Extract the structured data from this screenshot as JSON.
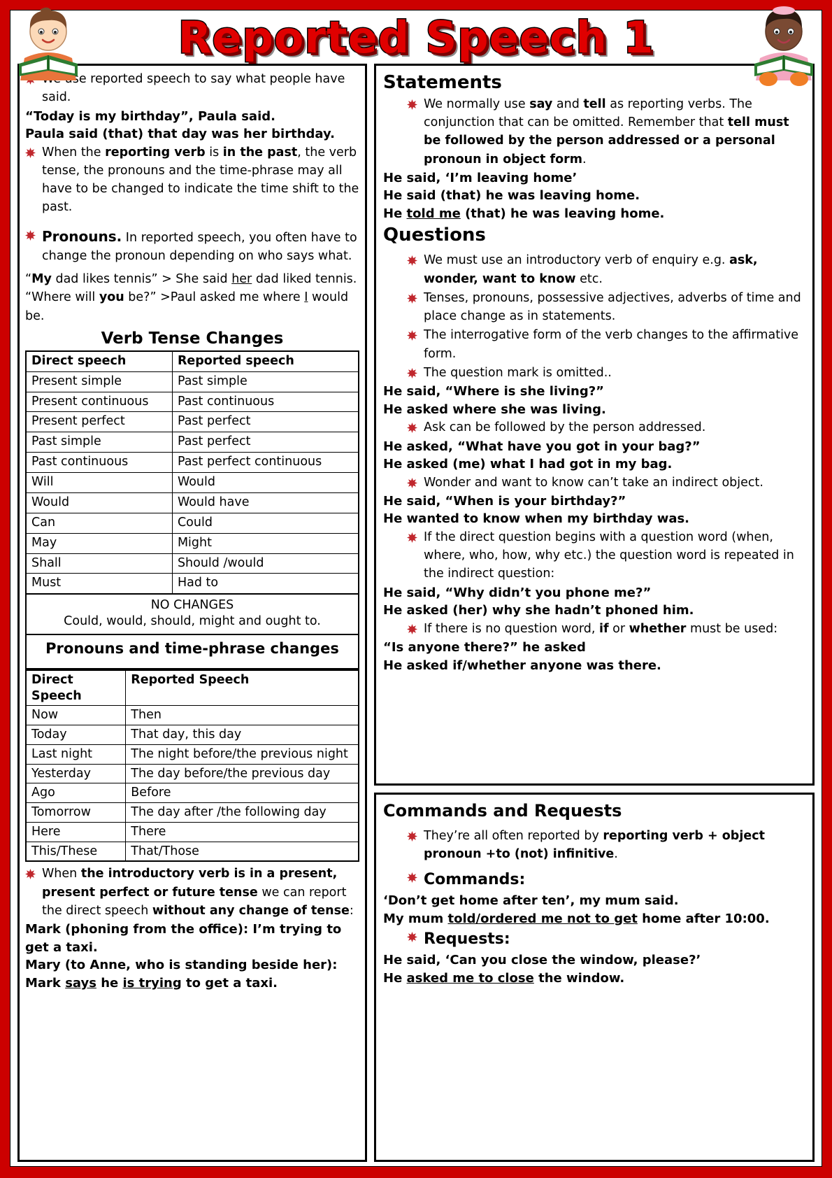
{
  "title": "Reported Speech 1",
  "theme": {
    "border_red": "#cc0000",
    "title_red": "#e00000",
    "bullet_red": "#c0272d"
  },
  "left": {
    "intro_bullet": "We use reported speech to say what people have said.",
    "example_1": "“Today is my birthday”, Paula said.",
    "example_2": "Paula said (that) that day was her birthday.",
    "bullet_past": {
      "p1": "When the ",
      "b1": "reporting verb",
      "p2": " is ",
      "b2": "in the past",
      "p3": ", the verb tense, the pronouns and the time-phrase may all have to be changed to indicate the time shift to the past."
    },
    "bullet_pronouns": {
      "head": "Pronouns.",
      "rest": " In reported speech, you often have to change the pronoun depending on who says what."
    },
    "pronoun_example_1": {
      "b1": "My",
      "p1": " dad likes tennis” > She said ",
      "u1": "her",
      "p2": " dad liked tennis."
    },
    "pronoun_example_1_open": "“",
    "pronoun_example_2": {
      "p0": "“Where will ",
      "b1": "you",
      "p1": " be?” >Paul asked me where ",
      "u1": "I",
      "p2": " would be."
    },
    "verb_tense_title": "Verb Tense Changes",
    "verb_table": {
      "headers": [
        "Direct speech",
        "Reported speech"
      ],
      "rows": [
        [
          "Present simple",
          "Past simple"
        ],
        [
          "Present continuous",
          "Past continuous"
        ],
        [
          "Present perfect",
          "Past perfect"
        ],
        [
          "Past simple",
          "Past perfect"
        ],
        [
          "Past continuous",
          "Past perfect continuous"
        ],
        [
          "Will",
          "Would"
        ],
        [
          "Would",
          "Would  have"
        ],
        [
          "Can",
          "Could"
        ],
        [
          "May",
          "Might"
        ],
        [
          "Shall",
          "Should /would"
        ],
        [
          "Must",
          "Had to"
        ]
      ]
    },
    "no_changes_title": "NO CHANGES",
    "no_changes_sub": "Could, would, should, might and ought to.",
    "pronouns_time_title": "Pronouns and time-phrase changes",
    "time_table": {
      "headers": [
        "Direct Speech",
        "Reported Speech"
      ],
      "rows": [
        [
          "Now",
          "Then"
        ],
        [
          "Today",
          "That day, this day"
        ],
        [
          "Last night",
          "The night before/the previous night"
        ],
        [
          "Yesterday",
          "The day before/the previous day"
        ],
        [
          "Ago",
          "Before"
        ],
        [
          "Tomorrow",
          "The day after /the following day"
        ],
        [
          "Here",
          "There"
        ],
        [
          "This/These",
          "That/Those"
        ]
      ]
    },
    "bullet_intro_verb": {
      "p1": "When ",
      "b1": "the introductory verb is in a present, present perfect or future tense",
      "p2": " we can report the direct speech ",
      "b2": "without any change of tense",
      "p3": ":"
    },
    "mark_line": "Mark (phoning from the office): I’m trying to get a taxi.",
    "mary_line": {
      "p1": "Mary (to Anne, who is standing beside her): Mark ",
      "u1": "says",
      "p2": " he ",
      "u2": "is trying",
      "p3": " to get a taxi."
    }
  },
  "right": {
    "statements_heading": "Statements",
    "statements_bullet": {
      "p1": "We normally use ",
      "b1": "say",
      "p2": " and ",
      "b2": "tell",
      "p3": " as reporting verbs. The conjunction that can be omitted. Remember that ",
      "b3": "tell must be followed by the person addressed or a personal pronoun in object form",
      "p4": "."
    },
    "statement_lines": [
      "He said, ‘I’m leaving home’",
      " He said (that) he was leaving home."
    ],
    "statement_told_line": {
      "p1": "He ",
      "u1": "told me",
      "p2": " (that) he was leaving home."
    },
    "questions_heading": "Questions",
    "question_bullets": [
      {
        "p1": "We must use an introductory verb of enquiry e.g. ",
        "b1": "ask,  wonder,  want to know",
        "p2": " etc."
      },
      {
        "p1": "Tenses, pronouns, possessive adjectives, adverbs of time and place change as in statements.",
        "b1": "",
        "p2": ""
      },
      {
        "p1": "The interrogative form of the verb changes to the affirmative form.",
        "b1": "",
        "p2": ""
      },
      {
        "p1": "The question mark is omitted..",
        "b1": "",
        "p2": ""
      }
    ],
    "q_example_1a": "He said, “Where is she living?”",
    "q_example_1b": "He asked where she was living.",
    "q_bullet_ask": "Ask can be followed by the person addressed.",
    "q_example_2a": "He asked, “What have you got in your bag?”",
    "q_example_2b": " He asked (me) what I had got in my bag.",
    "q_bullet_wonder": "Wonder and want to know can’t take an indirect object.",
    "q_example_3a": "He said, “When is your birthday?”",
    "q_example_3b": " He wanted to know when my birthday was.",
    "q_bullet_qword": "If the direct question begins with a question word (when, where, who, how, why etc.) the question word is repeated in the indirect question:",
    "q_example_4a": "He said, “Why didn’t you phone me?”",
    "q_example_4b": " He asked (her) why she hadn’t phoned him.",
    "q_bullet_if": {
      "p1": "If there is no question word, ",
      "b1": "if",
      "p2": " or ",
      "b2": "whether",
      "p3": " must be used:"
    },
    "q_example_5a": "“Is anyone there?” he asked",
    "q_example_5b": " He asked if/whether anyone was there.",
    "commands_heading": "Commands and Requests",
    "commands_bullet": {
      "p1": "They’re all often reported by ",
      "b1": "reporting verb + object pronoun +to (not) infinitive",
      "p2": "."
    },
    "commands_label": "Commands:",
    "commands_example_1": "‘Don’t get home after ten’, my mum said.",
    "commands_example_2": {
      "p1": "My mum ",
      "u1": "told/ordered me not to get",
      "p2": " home after 10:00."
    },
    "requests_label": "Requests:",
    "requests_example_1": "He said, ‘Can you close the window, please?’",
    "requests_example_2": {
      "p1": " He ",
      "u1": "asked me to close",
      "p2": " the window."
    }
  }
}
